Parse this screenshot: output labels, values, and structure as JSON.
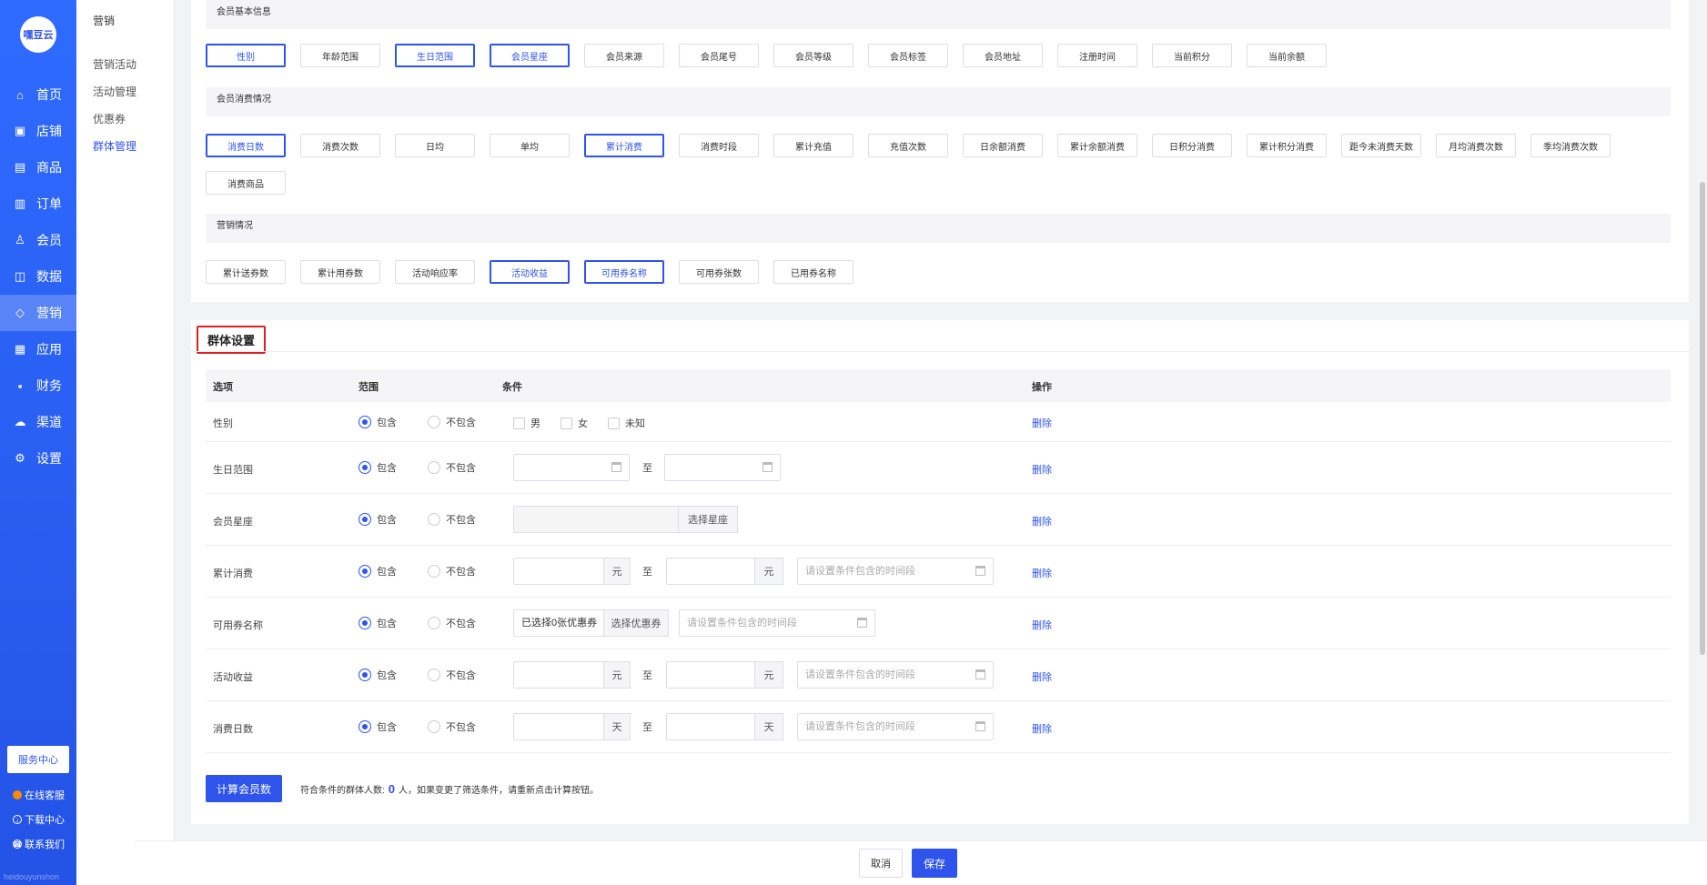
{
  "nav": {
    "logo": "嘿豆云",
    "items": [
      {
        "label": "首页",
        "icon": "home-icon",
        "glyph": "⌂"
      },
      {
        "label": "店铺",
        "icon": "shop-icon",
        "glyph": "▣"
      },
      {
        "label": "商品",
        "icon": "goods-icon",
        "glyph": "▤"
      },
      {
        "label": "订单",
        "icon": "order-icon",
        "glyph": "▥"
      },
      {
        "label": "会员",
        "icon": "member-icon",
        "glyph": "♙"
      },
      {
        "label": "数据",
        "icon": "data-icon",
        "glyph": "◫"
      },
      {
        "label": "营销",
        "icon": "tag-icon",
        "glyph": "◇"
      },
      {
        "label": "应用",
        "icon": "app-icon",
        "glyph": "▦"
      },
      {
        "label": "财务",
        "icon": "finance-icon",
        "glyph": "▪"
      },
      {
        "label": "渠道",
        "icon": "channel-icon",
        "glyph": "☁"
      },
      {
        "label": "设置",
        "icon": "gear-icon",
        "glyph": "⚙"
      }
    ],
    "active_index": 6,
    "service_center": "服务中心",
    "online_service": "在线客服",
    "download_center": "下载中心",
    "contact_us": "联系我们",
    "footer_text": "heidouyunshon"
  },
  "submenu": {
    "header": "营销",
    "items": [
      "营销活动",
      "活动管理",
      "优惠券",
      "群体管理"
    ],
    "active_index": 3
  },
  "sections": {
    "basic": {
      "title": "会员基本信息",
      "tags": [
        "性别",
        "年龄范围",
        "生日范围",
        "会员星座",
        "会员来源",
        "会员尾号",
        "会员等级",
        "会员标签",
        "会员地址",
        "注册时间",
        "当前积分",
        "当前余额"
      ],
      "selected": [
        0,
        2,
        3
      ]
    },
    "consume": {
      "title": "会员消费情况",
      "tags": [
        "消费日数",
        "消费次数",
        "日均",
        "单均",
        "累计消费",
        "消费时段",
        "累计充值",
        "充值次数",
        "日余额消费",
        "累计余额消费",
        "日积分消费",
        "累计积分消费",
        "距今未消费天数",
        "月均消费次数",
        "季均消费次数",
        "消费商品"
      ],
      "selected": [
        0,
        4
      ]
    },
    "marketing": {
      "title": "营销情况",
      "tags": [
        "累计送券数",
        "累计用券数",
        "活动响应率",
        "活动收益",
        "可用券名称",
        "可用券张数",
        "已用券名称"
      ],
      "selected": [
        3,
        4
      ]
    }
  },
  "group": {
    "title": "群体设置",
    "columns": {
      "option": "选项",
      "range": "范围",
      "condition": "条件",
      "action": "操作"
    },
    "include": "包含",
    "exclude": "不包含",
    "to": "至",
    "delete": "删除",
    "rows": {
      "gender": {
        "label": "性别",
        "options": [
          "男",
          "女",
          "未知"
        ]
      },
      "birthday": {
        "label": "生日范围"
      },
      "constellation": {
        "label": "会员星座",
        "button": "选择星座"
      },
      "total": {
        "label": "累计消费",
        "unit": "元",
        "placeholder": "请设置条件包含的时间段"
      },
      "coupon": {
        "label": "可用券名称",
        "value": "已选择0张优惠券",
        "button": "选择优惠券",
        "placeholder": "请设置条件包含的时间段"
      },
      "revenue": {
        "label": "活动收益",
        "unit": "元",
        "placeholder": "请设置条件包含的时间段"
      },
      "days": {
        "label": "消费日数",
        "unit": "天",
        "placeholder": "请设置条件包含的时间段"
      }
    },
    "calc_button": "计算会员数",
    "hint_prefix": "符合条件的群体人数:",
    "count": "0",
    "hint_suffix": "人，如果变更了筛选条件，请重新点击计算按钮。"
  },
  "footer": {
    "cancel": "取消",
    "save": "保存"
  },
  "colors": {
    "accent": "#2f54eb",
    "highlight": "#e02020"
  }
}
